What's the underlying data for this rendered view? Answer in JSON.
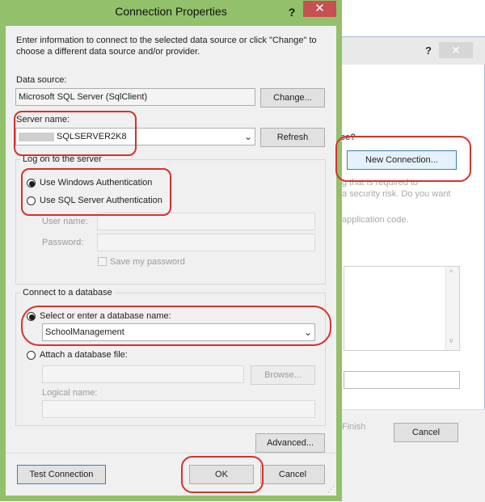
{
  "background_window": {
    "help": "?",
    "close": "✕",
    "partial_texts": [
      "ce?",
      "g that is required to",
      "a security risk. Do you want",
      "application code."
    ],
    "new_connection_button": "New Connection...",
    "finish_button": "Finish",
    "cancel_button": "Cancel"
  },
  "dialog": {
    "title": "Connection Properties",
    "help": "?",
    "close": "✕",
    "description": "Enter information to connect to the selected data source or click \"Change\" to choose a different data source and/or provider.",
    "data_source_label": "Data source:",
    "data_source_value": "Microsoft SQL Server (SqlClient)",
    "change_button": "Change...",
    "server_name_label": "Server name:",
    "server_name_value": "SQLSERVER2K8",
    "refresh_button": "Refresh",
    "logon_group": "Log on to the server",
    "windows_auth": "Use Windows Authentication",
    "sql_auth": "Use SQL Server Authentication",
    "user_name_label": "User name:",
    "password_label": "Password:",
    "save_password": "Save my password",
    "db_group": "Connect to a database",
    "select_db": "Select or enter a database name:",
    "db_value": "SchoolManagement",
    "attach_file": "Attach a database file:",
    "browse_button": "Browse...",
    "logical_name_label": "Logical name:",
    "advanced_button": "Advanced...",
    "test_connection_button": "Test Connection",
    "ok_button": "OK",
    "cancel_button": "Cancel"
  }
}
